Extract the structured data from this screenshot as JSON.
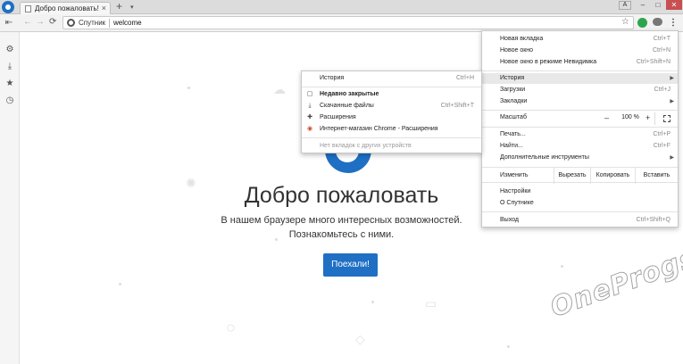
{
  "tab": {
    "title": "Добро пожаловать!",
    "close": "×",
    "new_tab": "+",
    "menu_arrow": "▾"
  },
  "window": {
    "profile": "A",
    "minimize": "–",
    "maximize": "□",
    "close": "✕"
  },
  "toolbar": {
    "back": "←",
    "forward": "→",
    "reload": "⟳",
    "site_name": "Спутник",
    "url": "welcome",
    "star": "☆",
    "menu": "⋮"
  },
  "sidebar": {
    "icons": [
      "pin-icon",
      "gear-icon",
      "download-icon",
      "star-icon",
      "history-icon"
    ]
  },
  "welcome": {
    "title": "Добро пожаловать",
    "line1": "В нашем браузере много интересных возможностей.",
    "line2": "Познакомьтесь с ними.",
    "button": "Поехали!"
  },
  "main_menu": {
    "items": [
      {
        "label": "Новая вкладка",
        "shortcut": "Ctrl+T"
      },
      {
        "label": "Новое окно",
        "shortcut": "Ctrl+N"
      },
      {
        "label": "Новое окно в режиме Невидимка",
        "shortcut": "Ctrl+Shift+N"
      },
      {
        "label": "История",
        "shortcut": ""
      },
      {
        "label": "Загрузки",
        "shortcut": "Ctrl+J"
      },
      {
        "label": "Закладки",
        "shortcut": ""
      },
      {
        "label": "Печать...",
        "shortcut": "Ctrl+P"
      },
      {
        "label": "Найти...",
        "shortcut": "Ctrl+F"
      },
      {
        "label": "Дополнительные инструменты",
        "shortcut": ""
      },
      {
        "label": "Настройки",
        "shortcut": ""
      },
      {
        "label": "О Спутнике",
        "shortcut": ""
      },
      {
        "label": "Выход",
        "shortcut": "Ctrl+Shift+Q"
      }
    ],
    "zoom": {
      "label": "Масштаб",
      "minus": "–",
      "value": "100 %",
      "plus": "+"
    },
    "edit": {
      "change": "Изменить",
      "cut": "Вырезать",
      "copy": "Копировать",
      "paste": "Вставить"
    }
  },
  "history_menu": {
    "items": [
      {
        "label": "История",
        "shortcut": "Ctrl+H"
      },
      {
        "label": "Недавно закрытые",
        "shortcut": ""
      },
      {
        "label": "Скачанные файлы",
        "shortcut": "Ctrl+Shift+T"
      },
      {
        "label": "Расширения",
        "shortcut": ""
      },
      {
        "label": "Интернет-магазин Chrome - Расширения",
        "shortcut": ""
      },
      {
        "label": "Нет вкладок с других устройств",
        "shortcut": ""
      }
    ]
  },
  "watermark": "OneProgs.ru",
  "colors": {
    "accent": "#1f6fc4",
    "extension_green": "#2ea44f",
    "close_red": "#c75050"
  }
}
